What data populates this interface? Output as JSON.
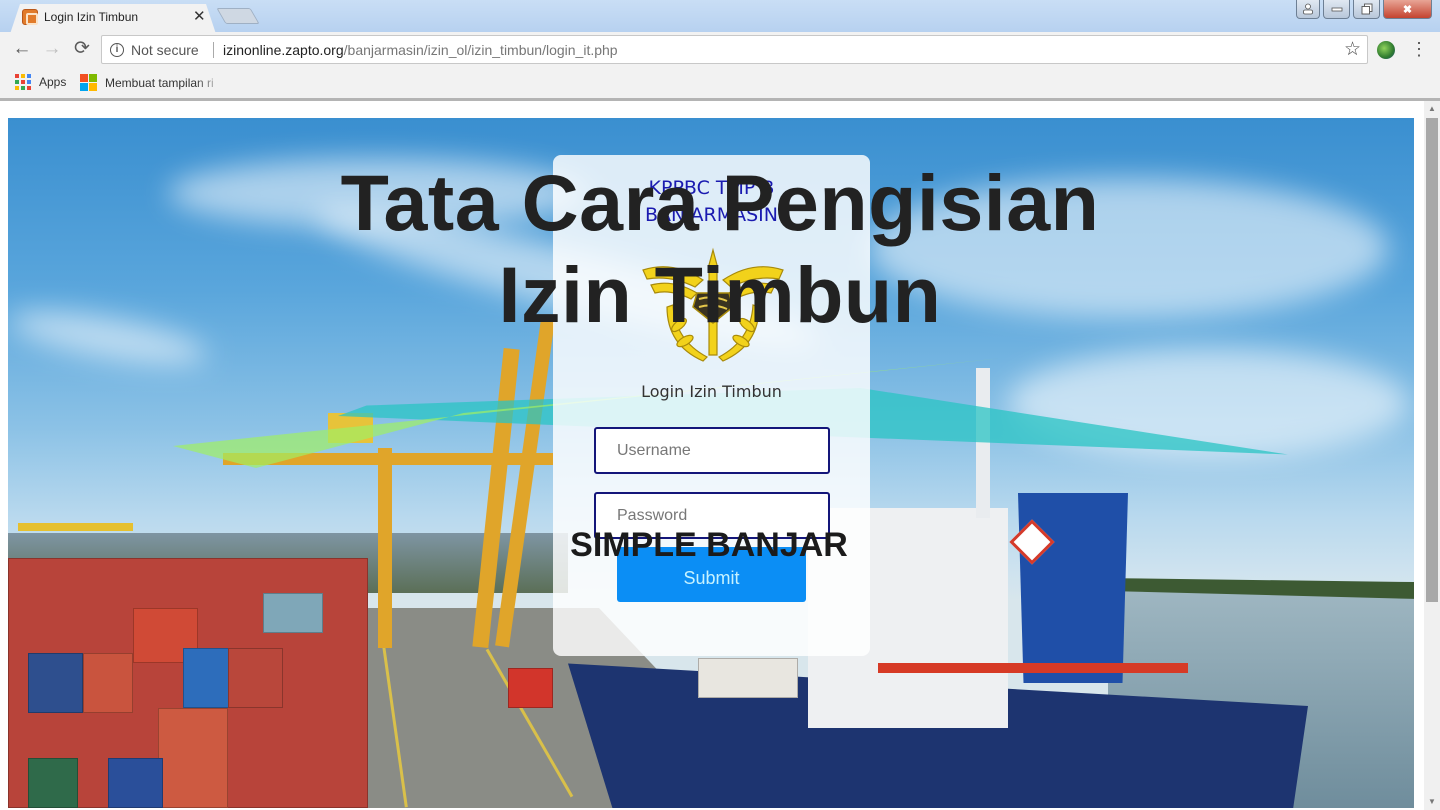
{
  "browser": {
    "tab": {
      "title": "Login Izin Timbun",
      "favicon": "xampp-favicon-icon",
      "close_glyph": "✕"
    },
    "window_controls": {
      "user": "user-icon",
      "minimize": "minimize-icon",
      "maximize": "restore-icon",
      "close": "close-icon",
      "close_glyph": "✖"
    },
    "nav": {
      "back_glyph": "←",
      "forward_glyph": "→",
      "reload_glyph": "⟳"
    },
    "omnibox": {
      "security_icon": "info-icon",
      "security_label": "Not secure",
      "url_host": "izinonline.zapto.org",
      "url_path": "/banjarmasin/izin_ol/izin_timbun/login_it.php",
      "star_glyph": "☆"
    },
    "menu_glyph": "⋮",
    "bookmarks": [
      {
        "label": "Apps",
        "icon": "apps-grid-icon"
      },
      {
        "label": "Membuat tampilan ri",
        "icon": "microsoft-logo-icon"
      }
    ]
  },
  "colors": {
    "brand_blue": "#1a1ab0",
    "field_border": "#14167a",
    "submit_bg": "#0b8ef5",
    "submit_text": "#c6f2ff",
    "overlay_text": "#222222"
  },
  "login": {
    "office_line1": "KPPBC TMP B",
    "office_line2": "BANJARMASIN",
    "emblem": "customs-emblem-icon",
    "heading": "Login Izin Timbun",
    "username_placeholder": "Username",
    "username_value": "",
    "password_placeholder": "Password",
    "password_value": "",
    "submit_label": "Submit"
  },
  "overlay": {
    "title_line1": "Tata Cara Pengisian",
    "title_line2": "Izin Timbun",
    "subtitle": "SIMPLE BANJAR"
  },
  "scrollbar": {
    "up_glyph": "▲",
    "down_glyph": "▼"
  }
}
